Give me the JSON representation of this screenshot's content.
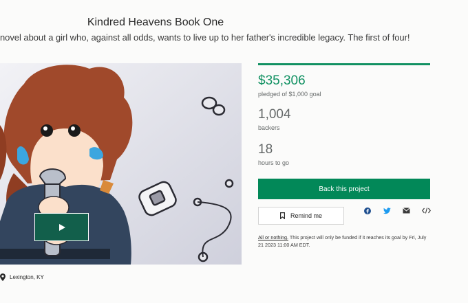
{
  "project": {
    "title": "Kindred Heavens Book One",
    "blurb": "novel about a girl who, against all odds, wants to live up to her father's incredible legacy. The first of four!",
    "location": "Lexington, KY"
  },
  "stats": {
    "progress_fraction": 1.0,
    "pledged_amount": "$35,306",
    "pledged_label": "pledged of $1,000 goal",
    "backers_count": "1,004",
    "backers_label": "backers",
    "hours_count": "18",
    "hours_label": "hours to go"
  },
  "actions": {
    "back_label": "Back this project",
    "remind_label": "Remind me"
  },
  "share_icons": [
    "facebook-icon",
    "twitter-icon",
    "email-icon",
    "embed-icon"
  ],
  "funding_note": {
    "link_text": "All or nothing.",
    "text": " This project will only be funded if it reaches its goal by Fri, July 21 2023 11:00 AM EDT."
  },
  "colors": {
    "accent_green": "#028858",
    "pledged_green": "#119162",
    "video_button": "#125f4b"
  }
}
